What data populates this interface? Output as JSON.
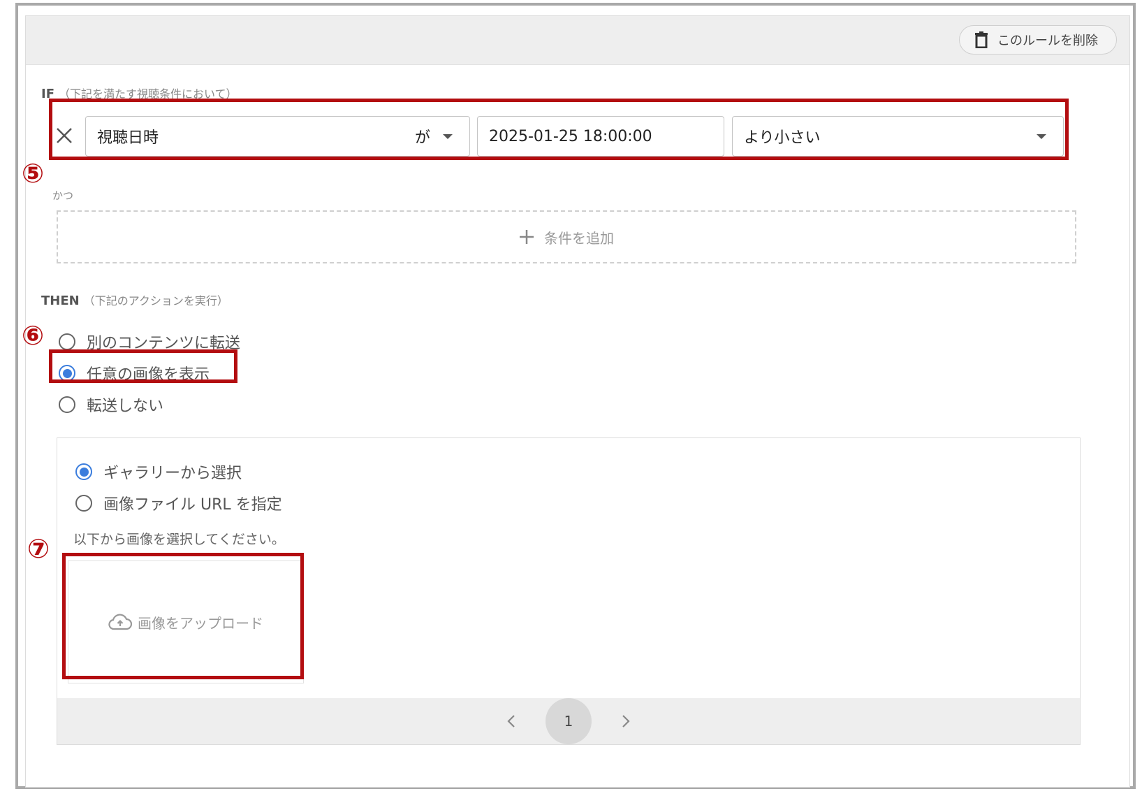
{
  "header": {
    "delete_rule_label": "このルールを削除"
  },
  "if_section": {
    "label": "IF",
    "sublabel": "（下記を満たす視聴条件において）",
    "condition": {
      "field": "視聴日時",
      "particle": "が",
      "value": "2025-01-25 18:00:00",
      "operator": "より小さい"
    },
    "and_label": "かつ",
    "add_condition_label": "条件を追加"
  },
  "then_section": {
    "label": "THEN",
    "sublabel": "（下記のアクションを実行）",
    "options": [
      {
        "label": "別のコンテンツに転送",
        "selected": false
      },
      {
        "label": "任意の画像を表示",
        "selected": true
      },
      {
        "label": "転送しない",
        "selected": false
      }
    ]
  },
  "image_panel": {
    "source_options": [
      {
        "label": "ギャラリーから選択",
        "selected": true
      },
      {
        "label": "画像ファイル URL を指定",
        "selected": false
      }
    ],
    "instruction": "以下から画像を選択してください。",
    "upload_label": "画像をアップロード",
    "pager": {
      "current_page": "1"
    }
  },
  "annotations": {
    "n5": "⑤",
    "n6": "⑥",
    "n7": "⑦"
  },
  "colors": {
    "accent": "#3b7ddd",
    "annotation_red": "#b30d10"
  }
}
